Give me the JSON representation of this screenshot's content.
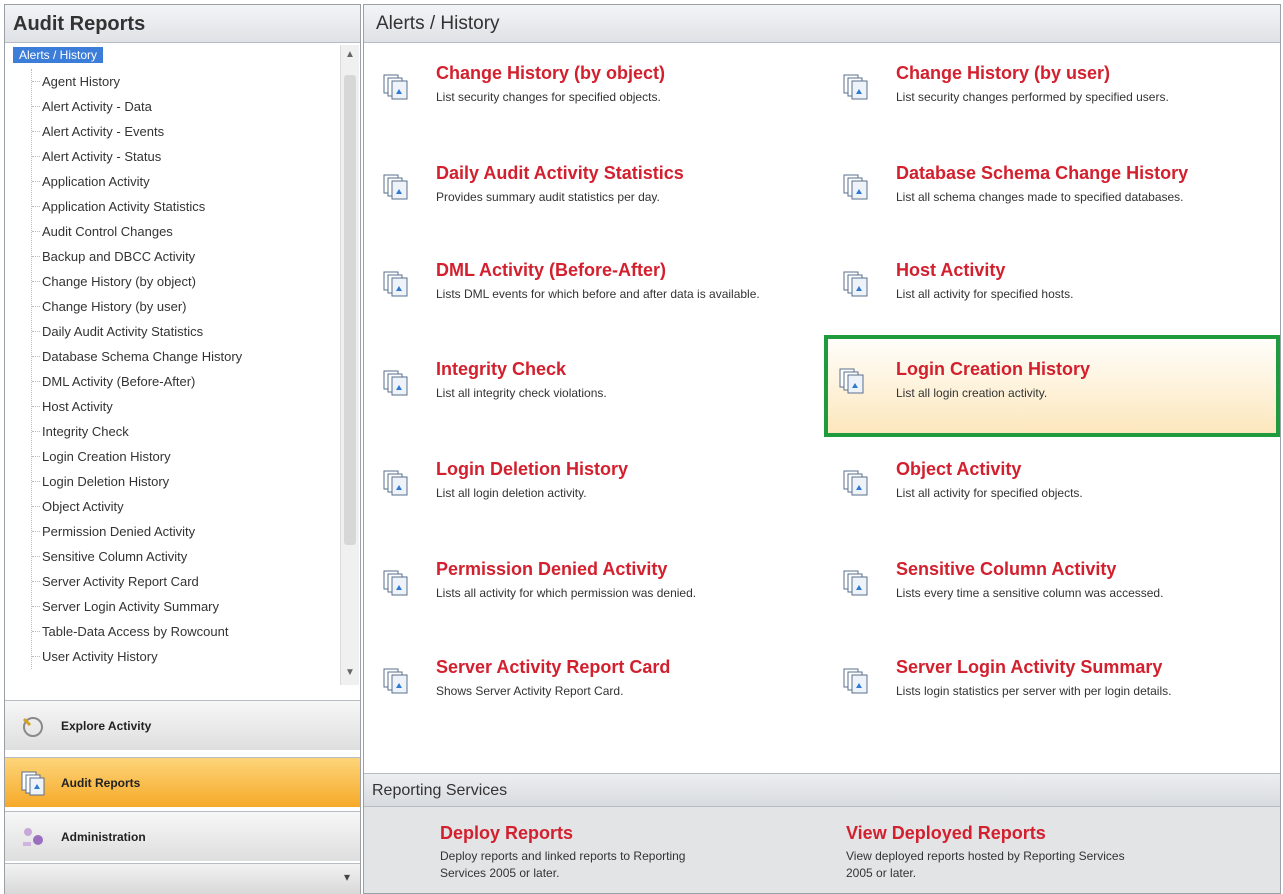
{
  "left_panel": {
    "title": "Audit Reports",
    "tree_root": "Alerts / History",
    "tree_items": [
      "Agent History",
      "Alert Activity - Data",
      "Alert Activity - Events",
      "Alert Activity - Status",
      "Application Activity",
      "Application Activity Statistics",
      "Audit Control Changes",
      "Backup and DBCC Activity",
      "Change History (by object)",
      "Change History (by user)",
      "Daily Audit Activity Statistics",
      "Database Schema Change History",
      "DML Activity (Before-After)",
      "Host Activity",
      "Integrity Check",
      "Login Creation History",
      "Login Deletion History",
      "Object Activity",
      "Permission Denied Activity",
      "Sensitive Column Activity",
      "Server Activity Report Card",
      "Server Login Activity Summary",
      "Table-Data Access by Rowcount",
      "User Activity History"
    ],
    "nav": {
      "explore": "Explore Activity",
      "audit_reports": "Audit Reports",
      "administration": "Administration"
    }
  },
  "main": {
    "header": "Alerts /  History",
    "reports": [
      {
        "title": "Change History (by object)",
        "desc": "List security changes for specified objects."
      },
      {
        "title": "Change History (by user)",
        "desc": "List security changes performed by specified users."
      },
      {
        "title": "Daily Audit Activity Statistics",
        "desc": "Provides summary audit statistics per day."
      },
      {
        "title": "Database Schema Change History",
        "desc": "List all schema changes made to specified databases."
      },
      {
        "title": "DML Activity (Before-After)",
        "desc": "Lists DML events for which before and after data is available."
      },
      {
        "title": "Host Activity",
        "desc": "List all activity for specified hosts."
      },
      {
        "title": "Integrity Check",
        "desc": "List all integrity check violations."
      },
      {
        "title": "Login Creation History",
        "desc": "List all login creation activity."
      },
      {
        "title": "Login Deletion History",
        "desc": "List all login deletion activity."
      },
      {
        "title": "Object Activity",
        "desc": "List all activity for specified objects."
      },
      {
        "title": "Permission Denied Activity",
        "desc": "Lists all activity for which permission was denied."
      },
      {
        "title": "Sensitive Column Activity",
        "desc": "Lists every time a sensitive column was accessed."
      },
      {
        "title": "Server Activity Report Card",
        "desc": "Shows Server Activity Report Card."
      },
      {
        "title": "Server Login Activity Summary",
        "desc": "Lists login statistics per server with per login details."
      }
    ],
    "reporting_services": {
      "header": "Reporting Services",
      "deploy_title": "Deploy Reports",
      "deploy_desc": "Deploy reports and linked reports to Reporting Services 2005 or later.",
      "view_title": "View Deployed Reports",
      "view_desc": "View deployed reports hosted by Reporting Services 2005 or later."
    }
  },
  "colors": {
    "title_red": "#d3202e",
    "highlight_border": "#1f9a3c",
    "active_nav": "#f6a928",
    "tree_selected": "#3b7dd8"
  },
  "icons": {
    "report": "report-icon",
    "explore": "explore-icon",
    "audit": "audit-reports-icon",
    "admin": "administration-icon"
  }
}
